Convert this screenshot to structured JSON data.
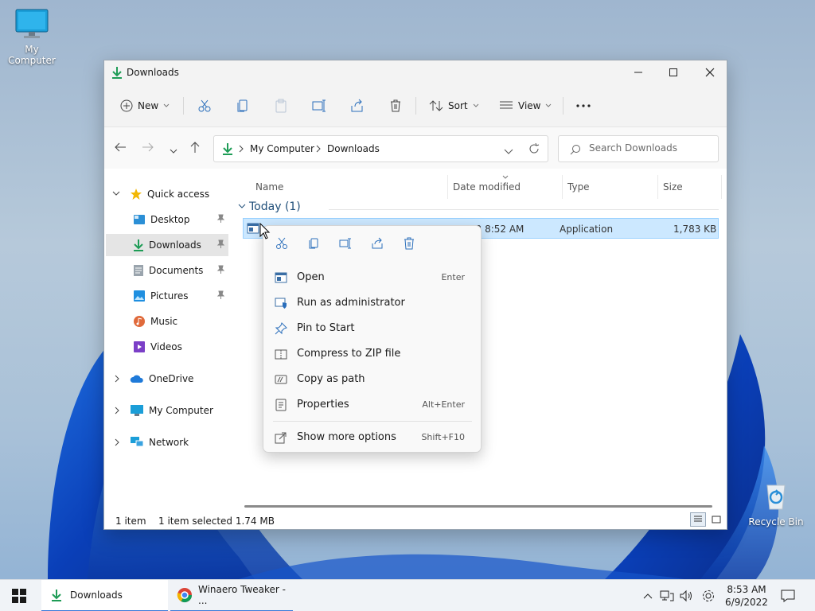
{
  "desktop": {
    "icons": [
      {
        "label": "My Computer"
      },
      {
        "label": "Recycle Bin"
      }
    ]
  },
  "window": {
    "title": "Downloads",
    "toolbar": {
      "new_label": "New",
      "sort_label": "Sort",
      "view_label": "View"
    },
    "address": {
      "segments": [
        "My Computer",
        "Downloads"
      ]
    },
    "search": {
      "placeholder": "Search Downloads"
    },
    "nav": {
      "quick_access": "Quick access",
      "items": [
        {
          "label": "Desktop"
        },
        {
          "label": "Downloads"
        },
        {
          "label": "Documents"
        },
        {
          "label": "Pictures"
        },
        {
          "label": "Music"
        },
        {
          "label": "Videos"
        }
      ],
      "onedrive": "OneDrive",
      "my_computer": "My Computer",
      "network": "Network"
    },
    "columns": [
      "Name",
      "Date modified",
      "Type",
      "Size"
    ],
    "group_label": "Today (1)",
    "file_row": {
      "date_visible": "22 8:52 AM",
      "type": "Application",
      "size": "1,783 KB"
    },
    "status": {
      "count": "1 item",
      "selected": "1 item selected  1.74 MB"
    }
  },
  "context_menu": {
    "items": [
      {
        "label": "Open",
        "shortcut": "Enter"
      },
      {
        "label": "Run as administrator",
        "shortcut": ""
      },
      {
        "label": "Pin to Start",
        "shortcut": ""
      },
      {
        "label": "Compress to ZIP file",
        "shortcut": ""
      },
      {
        "label": "Copy as path",
        "shortcut": ""
      },
      {
        "label": "Properties",
        "shortcut": "Alt+Enter"
      }
    ],
    "more": {
      "label": "Show more options",
      "shortcut": "Shift+F10"
    }
  },
  "taskbar": {
    "items": [
      {
        "label": "Downloads"
      },
      {
        "label": "Winaero Tweaker - ..."
      }
    ],
    "time": "8:53 AM",
    "date": "6/9/2022"
  },
  "colors": {
    "accent": "#0067c0",
    "selection": "#cce8ff",
    "download_green": "#1e9c56"
  }
}
